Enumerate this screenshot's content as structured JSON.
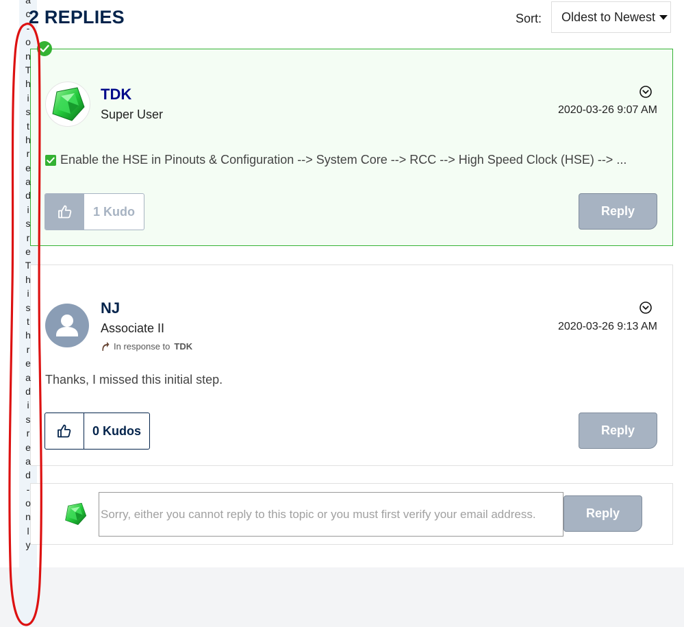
{
  "sidebar_strip": {
    "chars": [
      "a",
      "c",
      "-",
      "o",
      "n",
      "T",
      "h",
      "i",
      "s",
      "t",
      "h",
      "r",
      "e",
      "a",
      "d",
      "i",
      "s",
      "r",
      "e",
      "T",
      "h",
      "i",
      "s",
      "t",
      "h",
      "r",
      "e",
      "a",
      "d",
      "i",
      "s",
      "r",
      "e",
      "a",
      "d",
      "-",
      "o",
      "n",
      "l",
      "y"
    ]
  },
  "header": {
    "title": "2 REPLIES",
    "sort_label": "Sort:",
    "sort_value": "Oldest to Newest"
  },
  "replies": [
    {
      "author": "TDK",
      "rank": "Super User",
      "timestamp": "2020-03-26 9:07 AM",
      "body": "Enable the HSE in Pinouts & Configuration --> System Core --> RCC --> High Speed Clock (HSE) --> ...",
      "kudos": "1 Kudo",
      "reply_label": "Reply",
      "accepted_solution": true
    },
    {
      "author": "NJ",
      "rank": "Associate II",
      "in_response_prefix": "In response to",
      "in_response_to": "TDK",
      "timestamp": "2020-03-26 9:13 AM",
      "body": "Thanks, I missed this initial step.",
      "kudos": "0 Kudos",
      "reply_label": "Reply"
    }
  ],
  "composer": {
    "placeholder": "Sorry, either you cannot reply to this topic or you must first verify your email address.",
    "reply_label": "Reply"
  },
  "colors": {
    "accent_navy": "#03234b",
    "solution_green": "#34b233",
    "disabled_gray": "#a7b3c2",
    "annotation_red": "#dd1111"
  }
}
